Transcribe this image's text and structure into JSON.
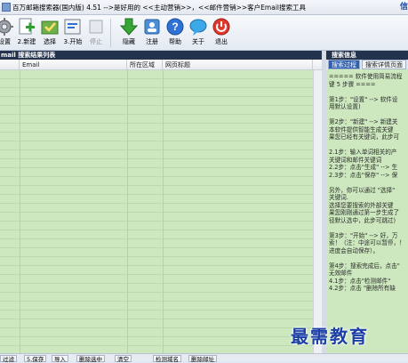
{
  "window": {
    "title": "百万邮箱搜索器(国内版) 4.51    -->是好用的 <<主动营销>>，<<邮件营销>>客户Email搜索工具",
    "corner_text": "信"
  },
  "toolbar": {
    "settings": "设置",
    "new": "2.新建",
    "select": "选择",
    "start": "3.开始",
    "stop": "停止",
    "hide": "隐藏",
    "register": "注册",
    "help": "帮助",
    "about": "关于",
    "exit": "退出"
  },
  "results": {
    "header": "mail 搜索结果列表",
    "columns": [
      "Email",
      "所在区域",
      "网页标题"
    ]
  },
  "info": {
    "header": "搜索信息",
    "tabs": [
      "搜索过程",
      "搜索详情页面"
    ],
    "lines": [
      "=====  软件使用简易流程",
      "键 5 步骤  ====",
      "",
      "第1步：\"设置\"  -->  软件设",
      "用默认设置)",
      "",
      "第2步：\"新建\"  -->  新建关",
      "  本软件提供智能生成关键",
      "果您已经有关键词，此步可",
      "",
      "  2.1步：输入单词相关的产",
      "关键词和邮件关键词",
      "  2.2步：点击\"生成\" --> 生",
      "  2.3步：点击\"保存\" --> 保",
      "",
      "  另外，你可以通过 \"选择\"",
      "关键词.",
      "  选择您要搜索的外部关键",
      "果您刚刚通过第一步生成了",
      "径默认选中，此步可跳过)",
      "",
      "第3步：\"开始\"  -->  好，万",
      "索！（注：中途可以暂停，！",
      "进度会自动保存）。",
      "",
      "第4步：搜索完成后，点击\"",
      "无效邮件",
      "  4.1步：点击\"检测邮件\"",
      "  4.2步：点击 \"删除所有缺"
    ]
  },
  "bottom": {
    "buttons": [
      "过滤",
      "5.保存",
      "导入",
      "删除选中",
      "清空",
      "检测域名",
      "删除邮址"
    ]
  },
  "watermark": "最需教育"
}
